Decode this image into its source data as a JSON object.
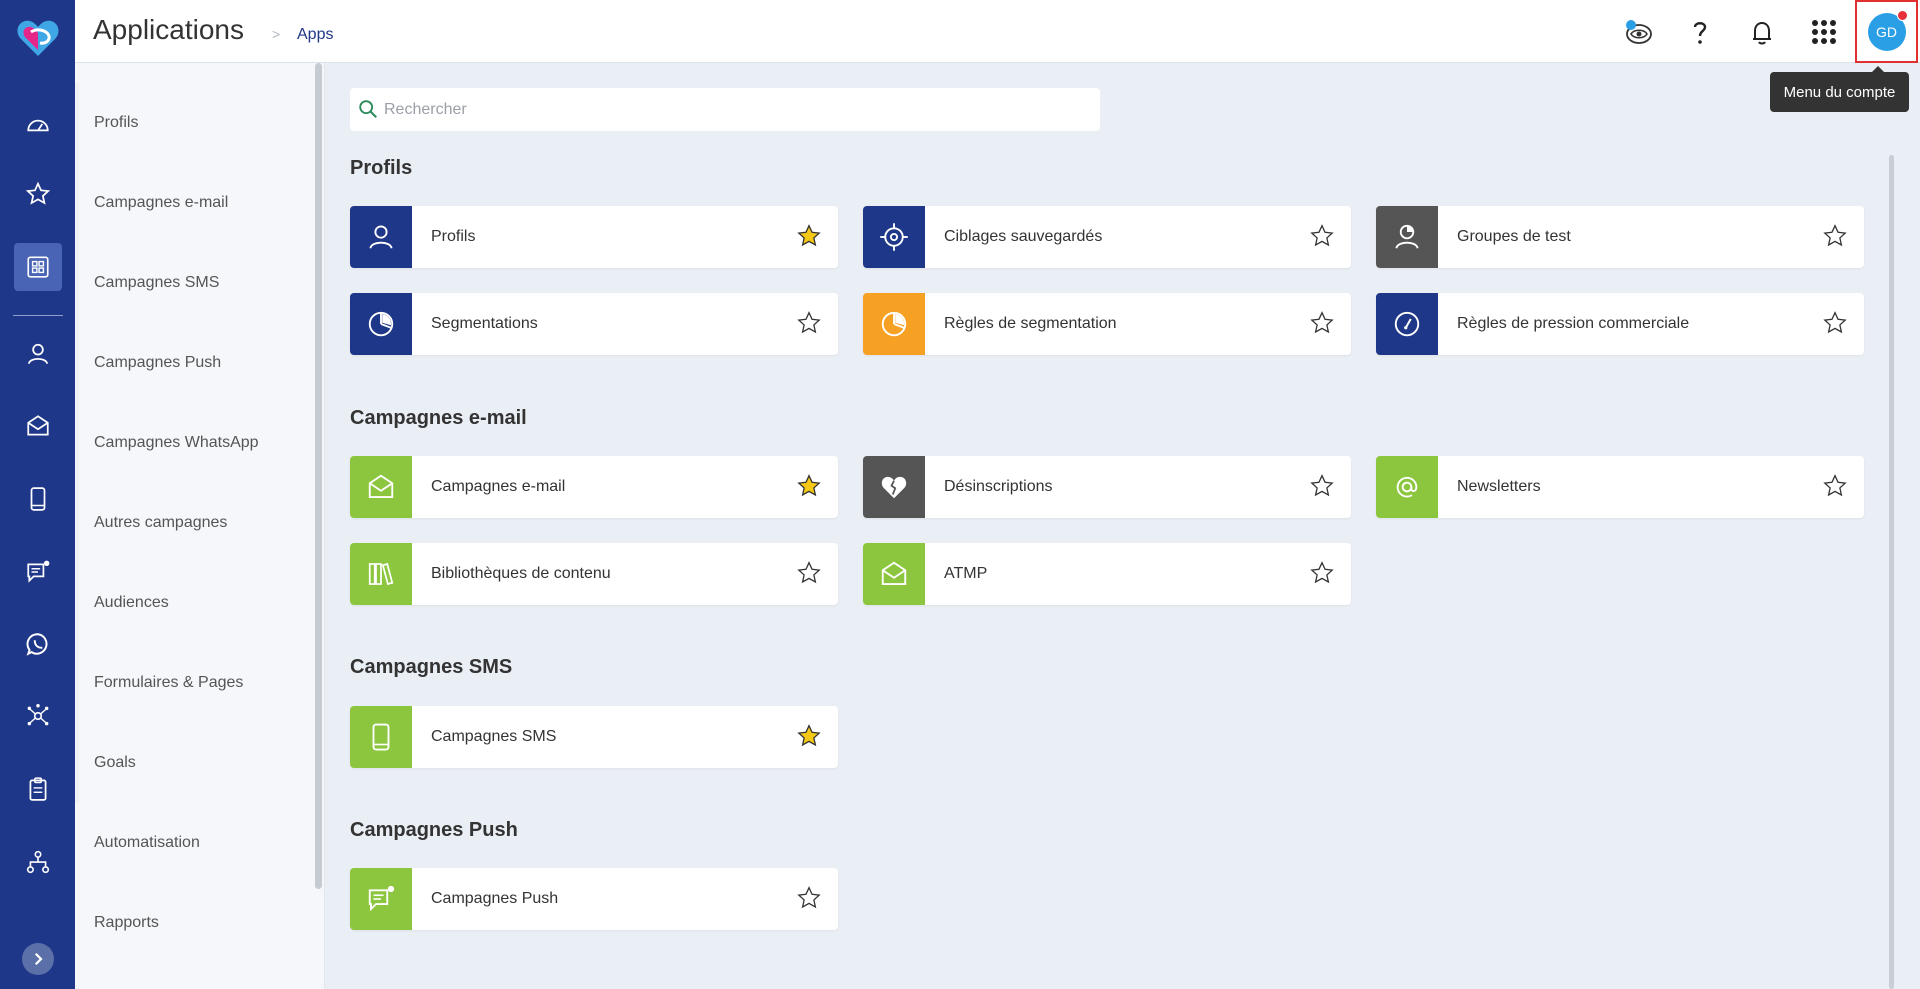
{
  "header": {
    "title": "Applications",
    "breadcrumb_separator": ">",
    "breadcrumb": "Apps",
    "avatar_initials": "GD",
    "tooltip": "Menu du compte",
    "icons": [
      "chat-assistant-icon",
      "help-icon",
      "bell-icon",
      "apps-grid-icon"
    ]
  },
  "rail": {
    "icons": [
      "dashboard-icon",
      "favorites-star-icon",
      "applications-grid-icon",
      "profile-icon",
      "email-icon",
      "mobile-sms-icon",
      "push-message-icon",
      "whatsapp-icon",
      "audiences-network-icon",
      "forms-clipboard-icon",
      "automation-tree-icon"
    ],
    "active": "applications-grid-icon"
  },
  "sidebar": {
    "items": [
      "Profils",
      "Campagnes e-mail",
      "Campagnes SMS",
      "Campagnes Push",
      "Campagnes WhatsApp",
      "Autres campagnes",
      "Audiences",
      "Formulaires & Pages",
      "Goals",
      "Automatisation",
      "Rapports"
    ]
  },
  "search": {
    "placeholder": "Rechercher"
  },
  "sections": [
    {
      "title": "Profils",
      "cards": [
        {
          "label": "Profils",
          "color": "#1f3788",
          "icon": "user-icon",
          "favorite": true
        },
        {
          "label": "Ciblages sauvegardés",
          "color": "#1f3788",
          "icon": "target-icon",
          "favorite": false
        },
        {
          "label": "Groupes de test",
          "color": "#555555",
          "icon": "test-group-icon",
          "favorite": false
        },
        {
          "label": "Segmentations",
          "color": "#1f3788",
          "icon": "pie-chart-icon",
          "favorite": false
        },
        {
          "label": "Règles de segmentation",
          "color": "#f6a124",
          "icon": "pie-chart-icon",
          "favorite": false
        },
        {
          "label": "Règles de pression commerciale",
          "color": "#1f3788",
          "icon": "gauge-icon",
          "favorite": false
        }
      ]
    },
    {
      "title": "Campagnes e-mail",
      "cards": [
        {
          "label": "Campagnes e-mail",
          "color": "#8cc63f",
          "icon": "envelope-icon",
          "favorite": true
        },
        {
          "label": "Désinscriptions",
          "color": "#555555",
          "icon": "broken-heart-icon",
          "favorite": false
        },
        {
          "label": "Newsletters",
          "color": "#8cc63f",
          "icon": "at-sign-icon",
          "favorite": false
        },
        {
          "label": "Bibliothèques de contenu",
          "color": "#8cc63f",
          "icon": "library-books-icon",
          "favorite": false
        },
        {
          "label": "ATMP",
          "color": "#8cc63f",
          "icon": "envelope-icon",
          "favorite": false
        }
      ]
    },
    {
      "title": "Campagnes SMS",
      "cards": [
        {
          "label": "Campagnes SMS",
          "color": "#8cc63f",
          "icon": "mobile-icon",
          "favorite": true
        }
      ]
    },
    {
      "title": "Campagnes Push",
      "cards": [
        {
          "label": "Campagnes Push",
          "color": "#8cc63f",
          "icon": "push-message-icon",
          "favorite": false
        }
      ]
    }
  ]
}
